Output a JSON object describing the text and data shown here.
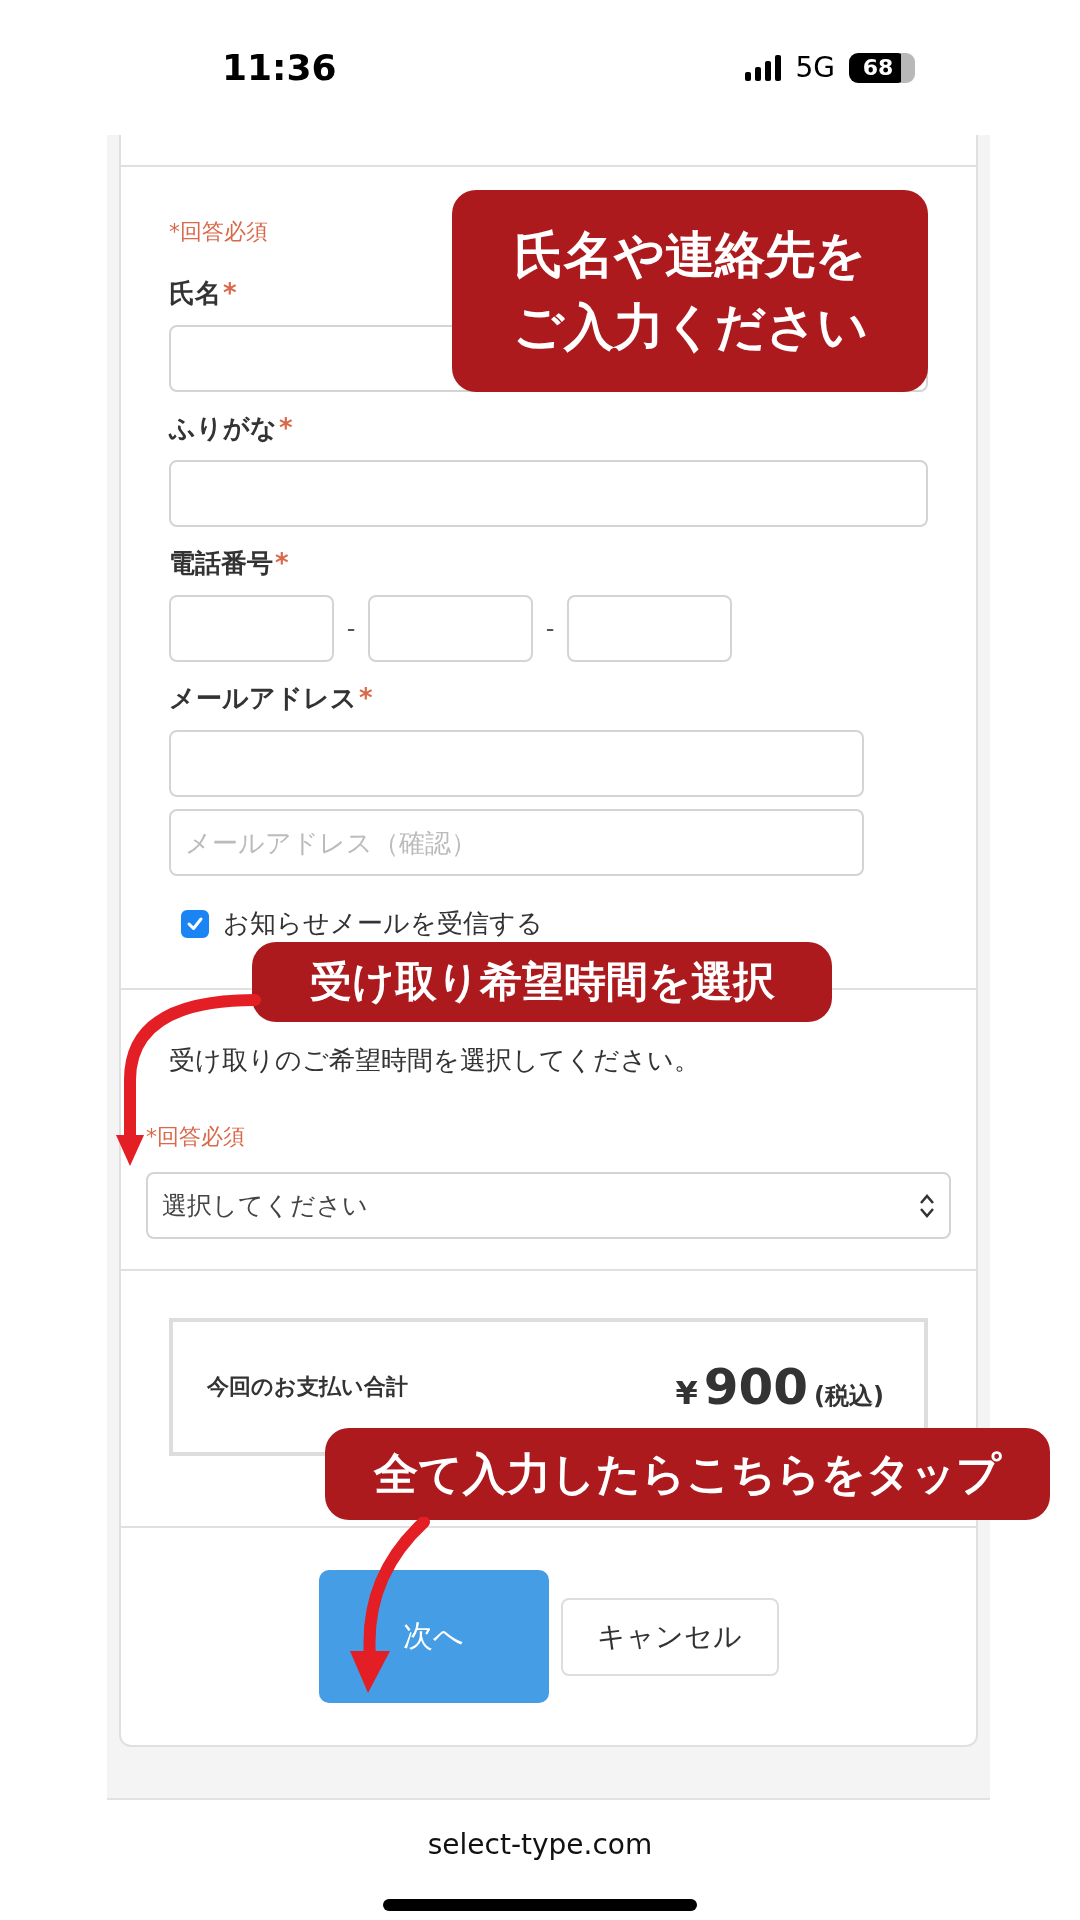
{
  "status_bar": {
    "time": "11:36",
    "network": "5G",
    "battery": "68"
  },
  "contact_section": {
    "required_note": "*回答必須",
    "fields": [
      {
        "kind": "text",
        "label": "氏名",
        "required_mark": "*"
      },
      {
        "kind": "text",
        "label": "ふりがな",
        "required_mark": "*"
      },
      {
        "kind": "phone",
        "label": "電話番号",
        "required_mark": "*",
        "separators": [
          "-",
          "-"
        ]
      },
      {
        "kind": "email",
        "label": "メールアドレス",
        "required_mark": "*",
        "confirm_placeholder": "メールアドレス（確認）"
      }
    ],
    "newsletter": {
      "label": "お知らせメールを受信する",
      "checked": true
    }
  },
  "pickup_section": {
    "instruction": "受け取りのご希望時間を選択してください。",
    "required_note": "*回答必須",
    "select": {
      "value": "選択してください"
    }
  },
  "total": {
    "label": "今回のお支払い合計",
    "currency": "¥",
    "amount": "900",
    "tax_note": "(税込)"
  },
  "buttons": [
    {
      "kind": "primary",
      "label": "次へ"
    },
    {
      "kind": "secondary",
      "label": "キャンセル"
    }
  ],
  "url_bar": {
    "url": "select-type.com"
  },
  "callouts": [
    {
      "lines": [
        "氏名や連絡先を",
        "ご入力ください"
      ]
    },
    {
      "lines": [
        "受け取り希望時間を選択"
      ],
      "arrow": true
    },
    {
      "lines": [
        "全て入力したらこちらをタップ"
      ],
      "arrow": true
    }
  ]
}
